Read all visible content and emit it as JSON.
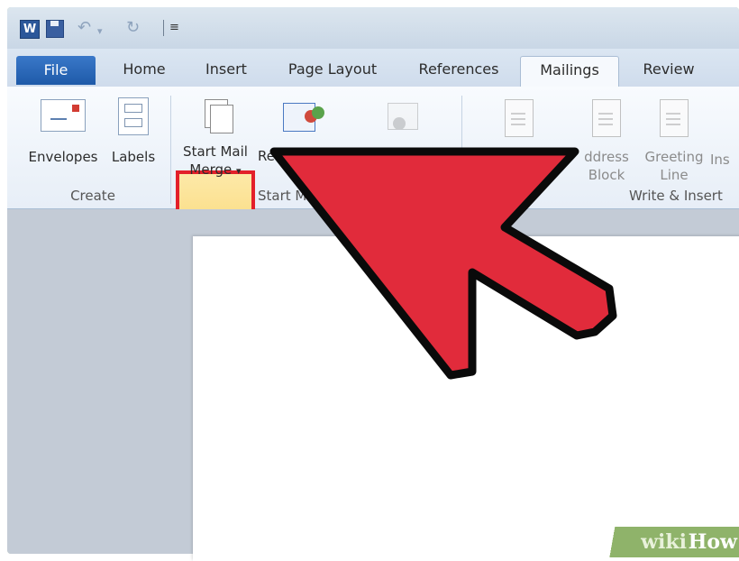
{
  "quick_access": {
    "app_letter": "W",
    "icons": [
      "word-app-icon",
      "save-icon",
      "undo-icon",
      "redo-icon",
      "customize-qat-icon"
    ]
  },
  "tabs": [
    {
      "label": "File"
    },
    {
      "label": "Home"
    },
    {
      "label": "Insert"
    },
    {
      "label": "Page Layout"
    },
    {
      "label": "References"
    },
    {
      "label": "Mailings"
    },
    {
      "label": "Review"
    }
  ],
  "active_tab": "Mailings",
  "ribbon": {
    "create": {
      "envelopes": "Envelopes",
      "labels": "Labels",
      "group_label": "Create"
    },
    "start_mail_merge": {
      "line1": "Start Mail",
      "line2": "Merge",
      "dropdown_glyph": "▾",
      "recipients_partial": "Rec",
      "group_label_partial": "Start M"
    },
    "write_insert": {
      "address_line1": "ddress",
      "address_line2": "Block",
      "greeting_line1": "Greeting",
      "greeting_line2": "Line",
      "insert_partial": "Ins",
      "group_label": "Write & Insert"
    }
  },
  "highlight_color": "#e3202a",
  "arrow_color": "#e12b3b",
  "watermark": {
    "part1": "wiki",
    "part2": "How"
  }
}
